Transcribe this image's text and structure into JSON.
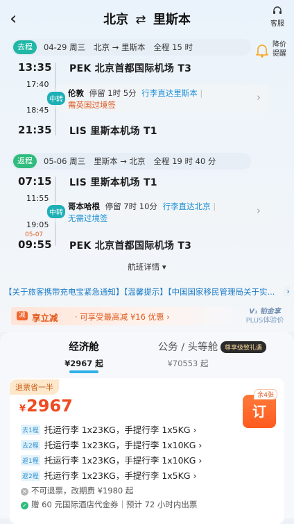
{
  "header": {
    "back_glyph": "‹",
    "title_from": "北京",
    "title_swap_glyph": "⇄",
    "title_to": "里斯本",
    "service_label": "客服",
    "price_alert_l1": "降价",
    "price_alert_l2": "提醒"
  },
  "outbound": {
    "tag": "去程",
    "date": "04-29 周三",
    "route": "北京 → 里斯本",
    "duration": "全程 15 时",
    "dep_time": "13:35",
    "dep_place": "PEK 北京首都国际机场 T3",
    "layover_arr": "17:40",
    "layover_dep": "18:45",
    "transfer_badge": "中转",
    "transfer_city": "伦敦",
    "transfer_stay": "停留 1时 5分",
    "transfer_baggage": "行李直达里斯本",
    "transfer_visa": "需英国过境签",
    "arr_time": "21:35",
    "arr_place": "LIS 里斯本机场 T1"
  },
  "inbound": {
    "tag": "返程",
    "date": "05-06 周三",
    "route": "里斯本 → 北京",
    "duration": "全程 19 时 40 分",
    "dep_time": "07:15",
    "dep_place": "LIS 里斯本机场 T1",
    "layover_arr": "11:55",
    "layover_dep": "19:05",
    "transfer_badge": "中转",
    "transfer_city": "哥本哈根",
    "transfer_stay": "停留 7时 10分",
    "transfer_baggage": "行李直达北京",
    "transfer_visa": "无需过境签",
    "arr_date_note": "05-07",
    "arr_time": "09:55",
    "arr_place": "PEK 北京首都国际机场 T3"
  },
  "flight_details_label": "航班详情 ▾",
  "notice": {
    "text": "【关于旅客携带充电宝紧急通知】【温馨提示】【中国国家移民管理局关于实...",
    "more": "›"
  },
  "promo": {
    "icon": "减",
    "label": "享立减",
    "desc": "· 可享受最高减 ¥16 优惠  ›"
  },
  "plus": {
    "l1": "V₁ 铂金享",
    "l2": "PLUS体验价"
  },
  "cabins": {
    "economy_name": "经济舱",
    "economy_price": "¥2967 起",
    "business_name": "公务 / 头等舱",
    "business_badge": "尊享级致礼遇",
    "business_price": "¥70553 起"
  },
  "fare": {
    "save_tag": "退票省一半",
    "currency": "¥",
    "price": "2967",
    "remain": "余4张",
    "book_label": "订",
    "rows": [
      {
        "seg": "去1程",
        "text": "托运行李 1x23KG，手提行李 1x5KG ›"
      },
      {
        "seg": "去2程",
        "text": "托运行李 1x23KG，手提行李 1x10KG ›"
      },
      {
        "seg": "返1程",
        "text": "托运行李 1x23KG，手提行李 1x10KG ›"
      },
      {
        "seg": "返2程",
        "text": "托运行李 1x23KG，手提行李 1x5KG ›"
      }
    ],
    "refund_rule": "不可退票，改期费 ¥1980 起",
    "gift_rule": "赠 60 元国际酒店代金券｜预计 72 小时内出票"
  },
  "colors": {
    "outbound_tag": "#21b7a6",
    "inbound_tag": "#2fbc7e",
    "accent_orange": "#ef4b21",
    "link_blue": "#1a8fd6"
  }
}
